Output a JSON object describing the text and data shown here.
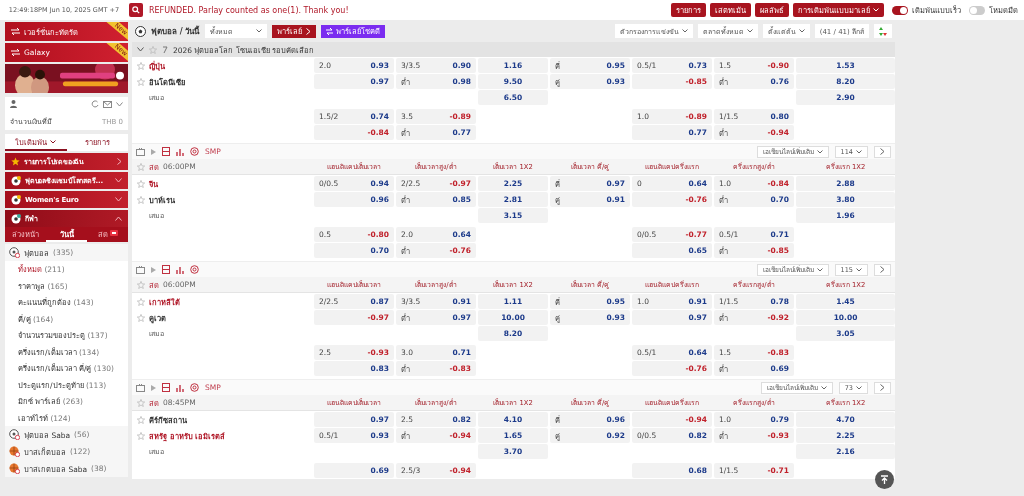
{
  "top_bar": {
    "clock": "12:49:18PM Jun 10, 2025 GMT +7",
    "message": "REFUNDED. Parlay counted as one(1). Thank you!",
    "buttons": [
      {
        "label": "รายการ",
        "dropdown": false
      },
      {
        "label": "เสตทเม้น",
        "dropdown": false
      },
      {
        "label": "ผลลัพธ์",
        "dropdown": false
      },
      {
        "label": "การเดิมพันแบบมาเลย์",
        "dropdown": true
      }
    ],
    "toggles": [
      {
        "label": "เดิมพันแบบเร็ว",
        "on": true
      },
      {
        "label": "โหมดมืด",
        "on": false
      }
    ]
  },
  "sidebar": {
    "promos": [
      {
        "label": "เวอร์ชั่นกะทัดรัด",
        "badge": "New"
      },
      {
        "label": "Galaxy",
        "badge": "New"
      }
    ],
    "account": {
      "balance_label": "จำนวนเงินที่มี",
      "balance": "THB 0"
    },
    "tabs": [
      {
        "label": "ใบเดิมพัน",
        "selected": true,
        "dropdown": true
      },
      {
        "label": "รายการ",
        "selected": false,
        "dropdown": false
      }
    ],
    "menu": [
      {
        "label": "รายการโปรดของฉัน",
        "kind": "favorites"
      },
      {
        "label": "ฟุตบอลชิงแชมป์โลกสตรี...",
        "kind": "competition",
        "expanded": false
      },
      {
        "label": "Women's Euro",
        "kind": "competition",
        "expanded": false
      },
      {
        "label": "กีฬา",
        "kind": "sports",
        "expanded": true
      }
    ],
    "sport_tabs": [
      {
        "label": "ล่วงหน้า",
        "selected": false,
        "live": false
      },
      {
        "label": "วันนี้",
        "selected": true,
        "live": false
      },
      {
        "label": "สด",
        "selected": false,
        "live": true
      }
    ],
    "sports": [
      {
        "name": "ฟุตบอล",
        "count": "(335)",
        "kind": "soccer",
        "children": [
          {
            "name": "ทั้งหมด",
            "count": "(211)",
            "selected": true
          },
          {
            "name": "ราคาพูล",
            "count": "(165)",
            "selected": false
          },
          {
            "name": "คะแนนที่ถูกต้อง",
            "count": "(143)",
            "selected": false
          },
          {
            "name": "คี่/คู่",
            "count": "(164)",
            "selected": false
          },
          {
            "name": "จำนวนรวมของประตู",
            "count": "(137)",
            "selected": false
          },
          {
            "name": "ครึ่งแรก/เต็มเวลา",
            "count": "(134)",
            "selected": false
          },
          {
            "name": "ครึ่งแรก/เต็มเวลา คี่/คู่",
            "count": "(130)",
            "selected": false
          },
          {
            "name": "ประตูแรก/ประตูท้าย",
            "count": "(113)",
            "selected": false
          },
          {
            "name": "มิกซ์ พาร์เลย์",
            "count": "(263)",
            "selected": false
          },
          {
            "name": "เอาท์ไรท์",
            "count": "(124)",
            "selected": false
          }
        ]
      },
      {
        "name": "ฟุตบอล Saba",
        "count": "(56)",
        "kind": "soccer"
      },
      {
        "name": "บาสเก็ตบอล",
        "count": "(122)",
        "kind": "basketball"
      },
      {
        "name": "บาสเกตบอล Saba",
        "count": "(38)",
        "kind": "basketball"
      }
    ]
  },
  "toolbar": {
    "sport": "ฟุตบอล / วันนี้",
    "filter": "ทั้งหมด",
    "parlay": "พาร์เลย์",
    "lucky_parlay": "พาร์เลย์โชคดี",
    "dropdowns": [
      "ตัวกรองการแข่งขัน",
      "ตลาดทั้งหมด",
      "ตั้งแต่ต้น"
    ],
    "league_count": "(41 / 41) ลีกส์"
  },
  "league": {
    "title": "2026 ฟุตบอลโลก โซนเอเชีย รอบคัดเลือก",
    "expanded": true
  },
  "matches": [
    {
      "rows": [
        {
          "kind": "team",
          "name": "ญี่ปุ่น",
          "favorite": true,
          "cells": [
            {
              "line": "2.0",
              "odds": "0.93"
            },
            {
              "line": "3/3.5",
              "odds": "0.90"
            },
            {
              "odds": "1.16"
            },
            {
              "line": "คี่",
              "odds": "0.95"
            },
            {
              "line": "0.5/1",
              "odds": "0.73"
            },
            {
              "line": "1.5",
              "odds": "-0.90"
            },
            {
              "odds": "1.53"
            }
          ]
        },
        {
          "kind": "team",
          "name": "อินโดนีเซีย",
          "favorite": false,
          "cells": [
            {
              "odds": "0.97"
            },
            {
              "line": "ต่ำ",
              "odds": "0.98"
            },
            {
              "odds": "9.50"
            },
            {
              "line": "คู่",
              "odds": "0.93"
            },
            {
              "odds": "-0.85"
            },
            {
              "line": "ต่ำ",
              "odds": "0.76"
            },
            {
              "odds": "8.20"
            }
          ]
        },
        {
          "kind": "draw",
          "name": "เสมอ",
          "cells": [
            null,
            null,
            {
              "odds": "6.50"
            },
            null,
            null,
            null,
            {
              "odds": "2.90"
            }
          ]
        }
      ],
      "extra": [
        {
          "cells": [
            {
              "line": "1.5/2",
              "odds": "0.74"
            },
            {
              "line": "3.5",
              "odds": "-0.89"
            },
            null,
            null,
            {
              "line": "1.0",
              "odds": "-0.89"
            },
            {
              "line": "1/1.5",
              "odds": "0.80"
            },
            null
          ]
        },
        {
          "cells": [
            {
              "odds": "-0.84"
            },
            {
              "line": "ต่ำ",
              "odds": "0.77"
            },
            null,
            null,
            {
              "odds": "0.77"
            },
            {
              "line": "ต่ำ",
              "odds": "-0.94"
            },
            null
          ]
        }
      ]
    },
    {
      "tools": {
        "smp": "SMP",
        "more": "เอเชียนไลน์เพิ่มเติม",
        "count": "114"
      },
      "header": {
        "status": "สด",
        "time": "06:00PM",
        "columns": [
          "แฮนดิแคปเต็มเวลา",
          "เต็มเวลาสูง/ต่ำ",
          "เต็มเวลา 1X2",
          "เต็มเวลา คี่/คู่",
          "แฮนดิแคปครึ่งแรก",
          "ครึ่งแรกสูง/ต่ำ",
          "ครึ่งแรก 1X2"
        ]
      },
      "rows": [
        {
          "kind": "team",
          "name": "จีน",
          "favorite": true,
          "cells": [
            {
              "line": "0/0.5",
              "odds": "0.94"
            },
            {
              "line": "2/2.5",
              "odds": "-0.97"
            },
            {
              "odds": "2.25"
            },
            {
              "line": "คี่",
              "odds": "0.97"
            },
            {
              "line": "0",
              "odds": "0.64"
            },
            {
              "line": "1.0",
              "odds": "-0.84"
            },
            {
              "odds": "2.88"
            }
          ]
        },
        {
          "kind": "team",
          "name": "บาห์เรน",
          "favorite": false,
          "cells": [
            {
              "odds": "0.96"
            },
            {
              "line": "ต่ำ",
              "odds": "0.85"
            },
            {
              "odds": "2.81"
            },
            {
              "line": "คู่",
              "odds": "0.91"
            },
            {
              "odds": "-0.76"
            },
            {
              "line": "ต่ำ",
              "odds": "0.70"
            },
            {
              "odds": "3.80"
            }
          ]
        },
        {
          "kind": "draw",
          "name": "เสมอ",
          "cells": [
            null,
            null,
            {
              "odds": "3.15"
            },
            null,
            null,
            null,
            {
              "odds": "1.96"
            }
          ]
        }
      ],
      "extra": [
        {
          "cells": [
            {
              "line": "0.5",
              "odds": "-0.80"
            },
            {
              "line": "2.0",
              "odds": "0.64"
            },
            null,
            null,
            {
              "line": "0/0.5",
              "odds": "-0.77"
            },
            {
              "line": "0.5/1",
              "odds": "0.71"
            },
            null
          ]
        },
        {
          "cells": [
            {
              "odds": "0.70"
            },
            {
              "line": "ต่ำ",
              "odds": "-0.76"
            },
            null,
            null,
            {
              "odds": "0.65"
            },
            {
              "line": "ต่ำ",
              "odds": "-0.85"
            },
            null
          ]
        }
      ]
    },
    {
      "tools": {
        "more": "เอเชียนไลน์เพิ่มเติม",
        "count": "115"
      },
      "header": {
        "status": "สด",
        "time": "06:00PM",
        "columns": [
          "แฮนดิแคปเต็มเวลา",
          "เต็มเวลาสูง/ต่ำ",
          "เต็มเวลา 1X2",
          "เต็มเวลา คี่/คู่",
          "แฮนดิแคปครึ่งแรก",
          "ครึ่งแรกสูง/ต่ำ",
          "ครึ่งแรก 1X2"
        ]
      },
      "rows": [
        {
          "kind": "team",
          "name": "เกาหลีใต้",
          "favorite": true,
          "cells": [
            {
              "line": "2/2.5",
              "odds": "0.87"
            },
            {
              "line": "3/3.5",
              "odds": "0.91"
            },
            {
              "odds": "1.11"
            },
            {
              "line": "คี่",
              "odds": "0.95"
            },
            {
              "line": "1.0",
              "odds": "0.91"
            },
            {
              "line": "1/1.5",
              "odds": "0.78"
            },
            {
              "odds": "1.45"
            }
          ]
        },
        {
          "kind": "team",
          "name": "คูเวต",
          "favorite": false,
          "cells": [
            {
              "odds": "-0.97"
            },
            {
              "line": "ต่ำ",
              "odds": "0.97"
            },
            {
              "odds": "10.00"
            },
            {
              "line": "คู่",
              "odds": "0.93"
            },
            {
              "odds": "0.97"
            },
            {
              "line": "ต่ำ",
              "odds": "-0.92"
            },
            {
              "odds": "10.00"
            }
          ]
        },
        {
          "kind": "draw",
          "name": "เสมอ",
          "cells": [
            null,
            null,
            {
              "odds": "8.20"
            },
            null,
            null,
            null,
            {
              "odds": "3.05"
            }
          ]
        }
      ],
      "extra": [
        {
          "cells": [
            {
              "line": "2.5",
              "odds": "-0.93"
            },
            {
              "line": "3.0",
              "odds": "0.71"
            },
            null,
            null,
            {
              "line": "0.5/1",
              "odds": "0.64"
            },
            {
              "line": "1.5",
              "odds": "-0.83"
            },
            null
          ]
        },
        {
          "cells": [
            {
              "odds": "0.83"
            },
            {
              "line": "ต่ำ",
              "odds": "-0.83"
            },
            null,
            null,
            {
              "odds": "-0.76"
            },
            {
              "line": "ต่ำ",
              "odds": "0.69"
            },
            null
          ]
        }
      ]
    },
    {
      "tools": {
        "smp": "SMP",
        "more": "เอเชียนไลน์เพิ่มเติม",
        "count": "73"
      },
      "header": {
        "status": "สด",
        "time": "08:45PM",
        "columns": [
          "แฮนดิแคปเต็มเวลา",
          "เต็มเวลาสูง/ต่ำ",
          "เต็มเวลา 1X2",
          "เต็มเวลา คี่/คู่",
          "แฮนดิแคปครึ่งแรก",
          "ครึ่งแรกสูง/ต่ำ",
          "ครึ่งแรก 1X2"
        ]
      },
      "rows": [
        {
          "kind": "team",
          "name": "คีร์กีซสถาน",
          "favorite": false,
          "cells": [
            {
              "odds": "0.97"
            },
            {
              "line": "2.5",
              "odds": "0.82"
            },
            {
              "odds": "4.10"
            },
            {
              "line": "คี่",
              "odds": "0.96"
            },
            {
              "odds": "-0.94"
            },
            {
              "line": "1.0",
              "odds": "0.79"
            },
            {
              "odds": "4.70"
            }
          ]
        },
        {
          "kind": "team",
          "name": "สหรัฐ อาหรับ เอมิเรตส์",
          "favorite": true,
          "cells": [
            {
              "line": "0.5/1",
              "odds": "0.93"
            },
            {
              "line": "ต่ำ",
              "odds": "-0.94"
            },
            {
              "odds": "1.65"
            },
            {
              "line": "คู่",
              "odds": "0.92"
            },
            {
              "line": "0/0.5",
              "odds": "0.82"
            },
            {
              "line": "ต่ำ",
              "odds": "-0.93"
            },
            {
              "odds": "2.25"
            }
          ]
        },
        {
          "kind": "draw",
          "name": "เสมอ",
          "cells": [
            null,
            null,
            {
              "odds": "3.70"
            },
            null,
            null,
            null,
            {
              "odds": "2.16"
            }
          ]
        }
      ],
      "extra": [
        {
          "cells": [
            {
              "odds": "0.69"
            },
            {
              "line": "2.5/3",
              "odds": "-0.94"
            },
            null,
            null,
            {
              "odds": "0.68"
            },
            {
              "line": "1/1.5",
              "odds": "-0.71"
            },
            null
          ]
        }
      ]
    }
  ]
}
